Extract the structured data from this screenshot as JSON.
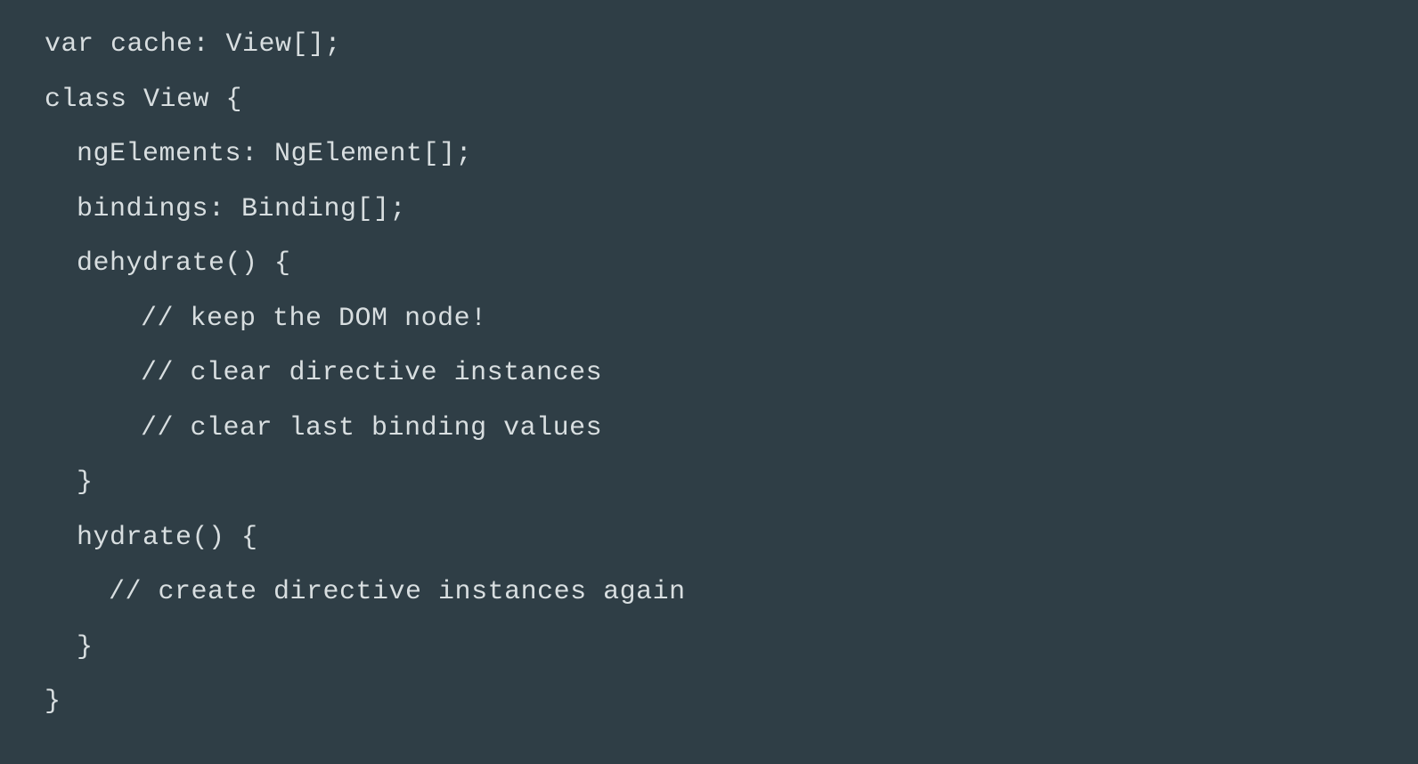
{
  "code": {
    "lines": [
      {
        "indent": 0,
        "text": "var cache: View[];"
      },
      {
        "indent": 0,
        "text": "class View {"
      },
      {
        "indent": 1,
        "text": "ngElements: NgElement[];"
      },
      {
        "indent": 1,
        "text": "bindings: Binding[];"
      },
      {
        "indent": 1,
        "text": "dehydrate() {"
      },
      {
        "indent": 3,
        "text": "// keep the DOM node!"
      },
      {
        "indent": 3,
        "text": "// clear directive instances"
      },
      {
        "indent": 3,
        "text": "// clear last binding values"
      },
      {
        "indent": 1,
        "text": "}"
      },
      {
        "indent": 1,
        "text": "hydrate() {"
      },
      {
        "indent": 2,
        "text": "// create directive instances again"
      },
      {
        "indent": 1,
        "text": "}"
      },
      {
        "indent": 0,
        "text": "}"
      }
    ]
  }
}
